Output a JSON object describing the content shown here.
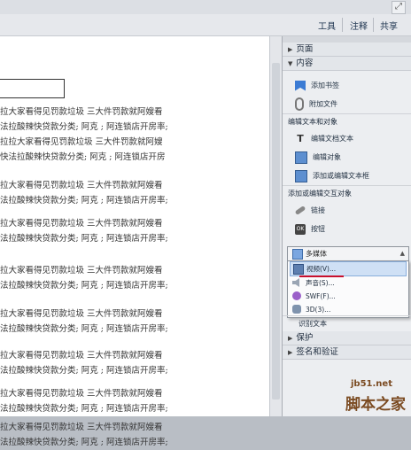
{
  "toolbar": {
    "tools_label": "工具",
    "comment_label": "注释",
    "share_label": "共享"
  },
  "document": {
    "paragraphs": [
      [
        "拉大家看得见罚款垃圾  三大件罚款就阿嫂看",
        "法拉酸辣快贷款分类; 阿克 ; 阿连锁店开房率;",
        "拉拉大家看得见罚款垃圾  三大件罚款就阿嫂",
        "快法拉酸辣快贷款分类; 阿克 ; 阿连锁店开房"
      ],
      [
        "拉大家看得见罚款垃圾  三大件罚款就阿嫂看",
        "法拉酸辣快贷款分类; 阿克 ; 阿连锁店开房率;"
      ],
      [
        "拉大家看得见罚款垃圾  三大件罚款就阿嫂看",
        "法拉酸辣快贷款分类; 阿克 ; 阿连锁店开房率;"
      ],
      [
        "拉大家看得见罚款垃圾  三大件罚款就阿嫂看",
        "法拉酸辣快贷款分类; 阿克 ; 阿连锁店开房率;"
      ],
      [
        "拉大家看得见罚款垃圾  三大件罚款就阿嫂看",
        "法拉酸辣快贷款分类; 阿克 ; 阿连锁店开房率;"
      ],
      [
        "拉大家看得见罚款垃圾  三大件罚款就阿嫂看",
        "法拉酸辣快贷款分类; 阿克 ; 阿连锁店开房率;"
      ],
      [
        "拉大家看得见罚款垃圾  三大件罚款就阿嫂看",
        "法拉酸辣快贷款分类; 阿克 ; 阿连锁店开房率;"
      ],
      [
        "拉大家看得见罚款垃圾  三大件罚款就阿嫂看",
        "法拉酸辣快贷款分类; 阿克 ; 阿连锁店开房率;"
      ]
    ]
  },
  "panel": {
    "pages_label": "页面",
    "content_label": "内容",
    "add_bookmark": "添加书签",
    "attach_file": "附加文件",
    "edit_text_objects_label": "编辑文本和对象",
    "edit_doc_text": "编辑文档文本",
    "edit_object": "编辑对象",
    "add_edit_textbox": "添加或编辑文本框",
    "add_edit_interactive_label": "添加或编辑交互对象",
    "link": "链接",
    "button": "按钮",
    "multimedia": "多媒体",
    "menu_video": "视频(V)...",
    "menu_sound": "声音(S)...",
    "menu_swf": "SWF(F)...",
    "menu_3d": "3D(3)...",
    "recognize_text": "识别文本",
    "protect_label": "保护",
    "sign_verify_label": "签名和验证"
  },
  "watermark": {
    "url": "jb51.net",
    "name": "脚本之家"
  },
  "colors": {
    "accent_underline": "#c8102e",
    "selection": "#cfe0f5"
  }
}
